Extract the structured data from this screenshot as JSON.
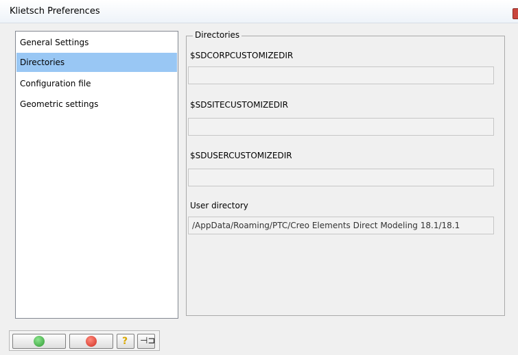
{
  "window": {
    "title": "Klietsch Preferences"
  },
  "nav": {
    "items": [
      {
        "label": "General Settings",
        "selected": false
      },
      {
        "label": "Directories",
        "selected": true
      },
      {
        "label": "Configuration file",
        "selected": false
      },
      {
        "label": "Geometric settings",
        "selected": false
      }
    ]
  },
  "directories": {
    "group_title": "Directories",
    "fields": [
      {
        "label": "$SDCORPCUSTOMIZEDIR",
        "value": ""
      },
      {
        "label": "$SDSITECUSTOMIZEDIR",
        "value": ""
      },
      {
        "label": "$SDUSERCUSTOMIZEDIR",
        "value": ""
      },
      {
        "label": "User directory",
        "value": "/AppData/Roaming/PTC/Creo Elements Direct Modeling 18.1/18.1"
      }
    ]
  },
  "buttons": {
    "ok_icon": "checkmark-icon",
    "cancel_icon": "cancel-x-icon",
    "help_icon": "question-icon",
    "pin_icon": "pin-icon",
    "help_glyph": "?",
    "pin_glyph": "⊣⊐"
  },
  "colors": {
    "selection": "#99c7f4",
    "ok": "#2f9a32",
    "cancel": "#d02e22"
  }
}
